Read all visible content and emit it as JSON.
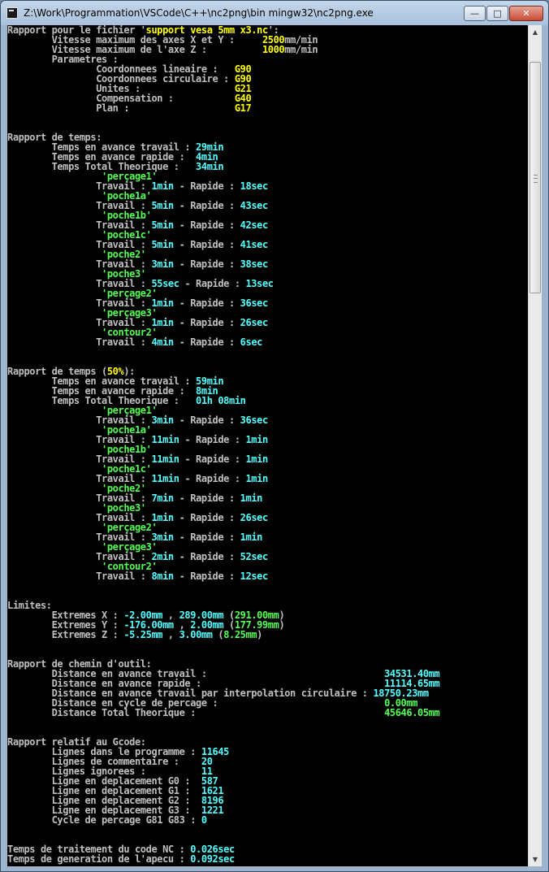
{
  "window": {
    "title": "Z:\\Work\\Programmation\\VSCode\\C++\\nc2png\\bin mingw32\\nc2png.exe"
  },
  "controls": {
    "minimize": "—",
    "maximize": "□",
    "close": "✕"
  },
  "icons": {
    "app": "console-app-icon",
    "scroll_up": "arrow-up-icon",
    "scroll_down": "arrow-down-icon"
  },
  "colors": {
    "console_bg": "#000000",
    "text": "#c0c0c0",
    "yellow": "#ffff00",
    "cyan": "#55ffff",
    "green": "#55ff55"
  },
  "console": {
    "lines": [
      [
        [
          "w",
          "Rapport pour le fichier '"
        ],
        [
          "y",
          "support vesa 5mm x3.nc"
        ],
        [
          "w",
          "':"
        ]
      ],
      [
        [
          "w",
          "        Vitesse maximum des axes X et Y :     "
        ],
        [
          "y",
          "2500"
        ],
        [
          "w",
          "mm/min"
        ]
      ],
      [
        [
          "w",
          "        Vitesse maximum de l'axe Z :          "
        ],
        [
          "y",
          "1000"
        ],
        [
          "w",
          "mm/min"
        ]
      ],
      [
        [
          "w",
          "        Parametres :"
        ]
      ],
      [
        [
          "w",
          "                Coordonnees lineaire :   "
        ],
        [
          "y",
          "G90"
        ]
      ],
      [
        [
          "w",
          "                Coordonnees circulaire : "
        ],
        [
          "y",
          "G90"
        ]
      ],
      [
        [
          "w",
          "                Unites :                 "
        ],
        [
          "y",
          "G21"
        ]
      ],
      [
        [
          "w",
          "                Compensation :           "
        ],
        [
          "y",
          "G40"
        ]
      ],
      [
        [
          "w",
          "                Plan :                   "
        ],
        [
          "y",
          "G17"
        ]
      ],
      [],
      [],
      [
        [
          "w",
          "Rapport de temps:"
        ]
      ],
      [
        [
          "w",
          "        Temps en avance travail : "
        ],
        [
          "c",
          "29min"
        ]
      ],
      [
        [
          "w",
          "        Temps en avance rapide :  "
        ],
        [
          "c",
          "4min"
        ]
      ],
      [
        [
          "w",
          "        Temps Total Theorique :   "
        ],
        [
          "c",
          "34min"
        ]
      ],
      [
        [
          "g",
          "                 'perçage1'"
        ]
      ],
      [
        [
          "w",
          "                Travail : "
        ],
        [
          "c",
          "1min"
        ],
        [
          "w",
          " - Rapide : "
        ],
        [
          "c",
          "18sec"
        ]
      ],
      [
        [
          "g",
          "                 'poche1a'"
        ]
      ],
      [
        [
          "w",
          "                Travail : "
        ],
        [
          "c",
          "5min"
        ],
        [
          "w",
          " - Rapide : "
        ],
        [
          "c",
          "43sec"
        ]
      ],
      [
        [
          "g",
          "                 'poche1b'"
        ]
      ],
      [
        [
          "w",
          "                Travail : "
        ],
        [
          "c",
          "5min"
        ],
        [
          "w",
          " - Rapide : "
        ],
        [
          "c",
          "42sec"
        ]
      ],
      [
        [
          "g",
          "                 'poche1c'"
        ]
      ],
      [
        [
          "w",
          "                Travail : "
        ],
        [
          "c",
          "5min"
        ],
        [
          "w",
          " - Rapide : "
        ],
        [
          "c",
          "41sec"
        ]
      ],
      [
        [
          "g",
          "                 'poche2'"
        ]
      ],
      [
        [
          "w",
          "                Travail : "
        ],
        [
          "c",
          "3min"
        ],
        [
          "w",
          " - Rapide : "
        ],
        [
          "c",
          "38sec"
        ]
      ],
      [
        [
          "g",
          "                 'poche3'"
        ]
      ],
      [
        [
          "w",
          "                Travail : "
        ],
        [
          "c",
          "55sec"
        ],
        [
          "w",
          " - Rapide : "
        ],
        [
          "c",
          "13sec"
        ]
      ],
      [
        [
          "g",
          "                 'perçage2'"
        ]
      ],
      [
        [
          "w",
          "                Travail : "
        ],
        [
          "c",
          "1min"
        ],
        [
          "w",
          " - Rapide : "
        ],
        [
          "c",
          "36sec"
        ]
      ],
      [
        [
          "g",
          "                 'perçage3'"
        ]
      ],
      [
        [
          "w",
          "                Travail : "
        ],
        [
          "c",
          "1min"
        ],
        [
          "w",
          " - Rapide : "
        ],
        [
          "c",
          "26sec"
        ]
      ],
      [
        [
          "g",
          "                 'contour2'"
        ]
      ],
      [
        [
          "w",
          "                Travail : "
        ],
        [
          "c",
          "4min"
        ],
        [
          "w",
          " - Rapide : "
        ],
        [
          "c",
          "6sec"
        ]
      ],
      [],
      [],
      [
        [
          "w",
          "Rapport de temps ("
        ],
        [
          "y",
          "50%"
        ],
        [
          "w",
          "):"
        ]
      ],
      [
        [
          "w",
          "        Temps en avance travail : "
        ],
        [
          "c",
          "59min"
        ]
      ],
      [
        [
          "w",
          "        Temps en avance rapide :  "
        ],
        [
          "c",
          "8min"
        ]
      ],
      [
        [
          "w",
          "        Temps Total Theorique :   "
        ],
        [
          "c",
          "01h 08min"
        ]
      ],
      [
        [
          "g",
          "                 'perçage1'"
        ]
      ],
      [
        [
          "w",
          "                Travail : "
        ],
        [
          "c",
          "3min"
        ],
        [
          "w",
          " - Rapide : "
        ],
        [
          "c",
          "36sec"
        ]
      ],
      [
        [
          "g",
          "                 'poche1a'"
        ]
      ],
      [
        [
          "w",
          "                Travail : "
        ],
        [
          "c",
          "11min"
        ],
        [
          "w",
          " - Rapide : "
        ],
        [
          "c",
          "1min"
        ]
      ],
      [
        [
          "g",
          "                 'poche1b'"
        ]
      ],
      [
        [
          "w",
          "                Travail : "
        ],
        [
          "c",
          "11min"
        ],
        [
          "w",
          " - Rapide : "
        ],
        [
          "c",
          "1min"
        ]
      ],
      [
        [
          "g",
          "                 'poche1c'"
        ]
      ],
      [
        [
          "w",
          "                Travail : "
        ],
        [
          "c",
          "11min"
        ],
        [
          "w",
          " - Rapide : "
        ],
        [
          "c",
          "1min"
        ]
      ],
      [
        [
          "g",
          "                 'poche2'"
        ]
      ],
      [
        [
          "w",
          "                Travail : "
        ],
        [
          "c",
          "7min"
        ],
        [
          "w",
          " - Rapide : "
        ],
        [
          "c",
          "1min"
        ]
      ],
      [
        [
          "g",
          "                 'poche3'"
        ]
      ],
      [
        [
          "w",
          "                Travail : "
        ],
        [
          "c",
          "1min"
        ],
        [
          "w",
          " - Rapide : "
        ],
        [
          "c",
          "26sec"
        ]
      ],
      [
        [
          "g",
          "                 'perçage2'"
        ]
      ],
      [
        [
          "w",
          "                Travail : "
        ],
        [
          "c",
          "3min"
        ],
        [
          "w",
          " - Rapide : "
        ],
        [
          "c",
          "1min"
        ]
      ],
      [
        [
          "g",
          "                 'perçage3'"
        ]
      ],
      [
        [
          "w",
          "                Travail : "
        ],
        [
          "c",
          "2min"
        ],
        [
          "w",
          " - Rapide : "
        ],
        [
          "c",
          "52sec"
        ]
      ],
      [
        [
          "g",
          "                 'contour2'"
        ]
      ],
      [
        [
          "w",
          "                Travail : "
        ],
        [
          "c",
          "8min"
        ],
        [
          "w",
          " - Rapide : "
        ],
        [
          "c",
          "12sec"
        ]
      ],
      [],
      [],
      [
        [
          "w",
          "Limites:"
        ]
      ],
      [
        [
          "w",
          "        Extremes X : "
        ],
        [
          "c",
          "-2.00mm"
        ],
        [
          "w",
          " , "
        ],
        [
          "c",
          "289.00mm"
        ],
        [
          "w",
          " ("
        ],
        [
          "g",
          "291.00mm"
        ],
        [
          "w",
          ")"
        ]
      ],
      [
        [
          "w",
          "        Extremes Y : "
        ],
        [
          "c",
          "-176.00mm"
        ],
        [
          "w",
          " , "
        ],
        [
          "c",
          "2.00mm"
        ],
        [
          "w",
          " ("
        ],
        [
          "g",
          "177.99mm"
        ],
        [
          "w",
          ")"
        ]
      ],
      [
        [
          "w",
          "        Extremes Z : "
        ],
        [
          "c",
          "-5.25mm"
        ],
        [
          "w",
          " , "
        ],
        [
          "c",
          "3.00mm"
        ],
        [
          "w",
          " ("
        ],
        [
          "g",
          "8.25mm"
        ],
        [
          "w",
          ")"
        ]
      ],
      [],
      [],
      [
        [
          "w",
          "Rapport de chemin d'outil:"
        ]
      ],
      [
        [
          "w",
          "        Distance en avance travail :                                "
        ],
        [
          "c",
          "34531.40mm"
        ]
      ],
      [
        [
          "w",
          "        Distance en avance rapide :                                 "
        ],
        [
          "c",
          "11114.65mm"
        ]
      ],
      [
        [
          "w",
          "        Distance en avance travail par interpolation circulaire : "
        ],
        [
          "c",
          "18750.23mm"
        ]
      ],
      [
        [
          "w",
          "        Distance en cycle de percage :                              "
        ],
        [
          "g",
          "0.00mm"
        ]
      ],
      [
        [
          "w",
          "        Distance Total Theorique :                                  "
        ],
        [
          "g",
          "45646.05mm"
        ]
      ],
      [],
      [],
      [
        [
          "w",
          "Rapport relatif au Gcode:"
        ]
      ],
      [
        [
          "w",
          "        Lignes dans le programme : "
        ],
        [
          "c",
          "11645"
        ]
      ],
      [
        [
          "w",
          "        Lignes de commentaire :    "
        ],
        [
          "c",
          "20"
        ]
      ],
      [
        [
          "w",
          "        Lignes ignorees :          "
        ],
        [
          "c",
          "11"
        ]
      ],
      [
        [
          "w",
          "        Ligne en deplacement G0 :  "
        ],
        [
          "c",
          "587"
        ]
      ],
      [
        [
          "w",
          "        Ligne en deplacement G1 :  "
        ],
        [
          "c",
          "1621"
        ]
      ],
      [
        [
          "w",
          "        Ligne en deplacement G2 :  "
        ],
        [
          "c",
          "8196"
        ]
      ],
      [
        [
          "w",
          "        Ligne en deplacement G3 :  "
        ],
        [
          "c",
          "1221"
        ]
      ],
      [
        [
          "w",
          "        Cycle de percage G81 G83 : "
        ],
        [
          "c",
          "0"
        ]
      ],
      [],
      [],
      [
        [
          "w",
          "Temps de traitement du code NC : "
        ],
        [
          "c",
          "0.026sec"
        ]
      ],
      [
        [
          "w",
          "Temps de generation de l'apecu : "
        ],
        [
          "c",
          "0.092sec"
        ]
      ]
    ]
  }
}
